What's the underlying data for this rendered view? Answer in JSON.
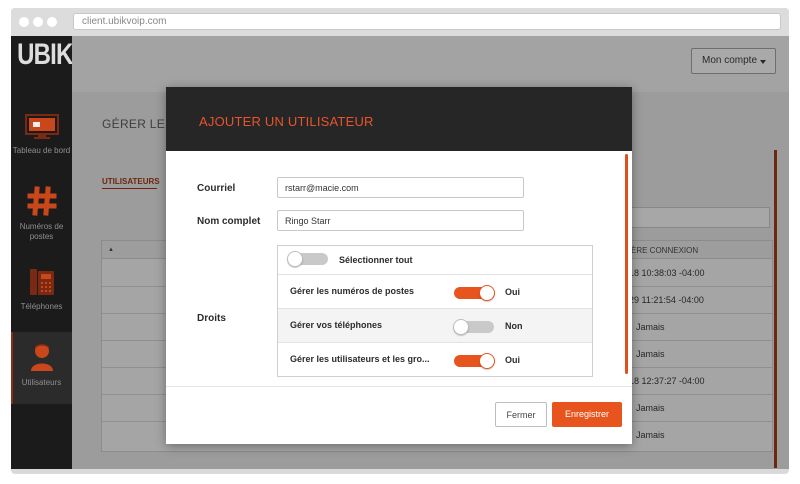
{
  "browser": {
    "url": "client.ubikvoip.com"
  },
  "sidebar": {
    "logo": "UBIK",
    "items": [
      {
        "label": "Tableau de bord"
      },
      {
        "label": "Numéros de postes"
      },
      {
        "label": "Téléphones"
      },
      {
        "label": "Utilisateurs"
      }
    ]
  },
  "topbar": {
    "account_label": "Mon compte"
  },
  "page": {
    "title": "GÉRER LES U",
    "tab_users": "UTILISATEURS",
    "table": {
      "col_last_login_header": "ÈRE CONNEXION",
      "rows": [
        "18 10:38:03 -04:00",
        "29 11:21:54 -04:00",
        "Jamais",
        "Jamais",
        "18 12:37:27 -04:00",
        "Jamais",
        "Jamais"
      ]
    }
  },
  "modal": {
    "title": "AJOUTER UN UTILISATEUR",
    "email_label": "Courriel",
    "email_value": "rstarr@macie.com",
    "fullname_label": "Nom complet",
    "fullname_value": "Ringo Starr",
    "rights_label": "Droits",
    "select_all_label": "Sélectionner tout",
    "rights": [
      {
        "label": "Gérer les numéros de postes",
        "value": "Oui",
        "on": true
      },
      {
        "label": "Gérer vos téléphones",
        "value": "Non",
        "on": false
      },
      {
        "label": "Gérer les utilisateurs et les gro...",
        "value": "Oui",
        "on": true
      }
    ],
    "close_label": "Fermer",
    "save_label": "Enregistrer"
  },
  "colors": {
    "accent": "#e8541e",
    "modal_header": "#262626",
    "sidebar": "#1b1b1b"
  }
}
